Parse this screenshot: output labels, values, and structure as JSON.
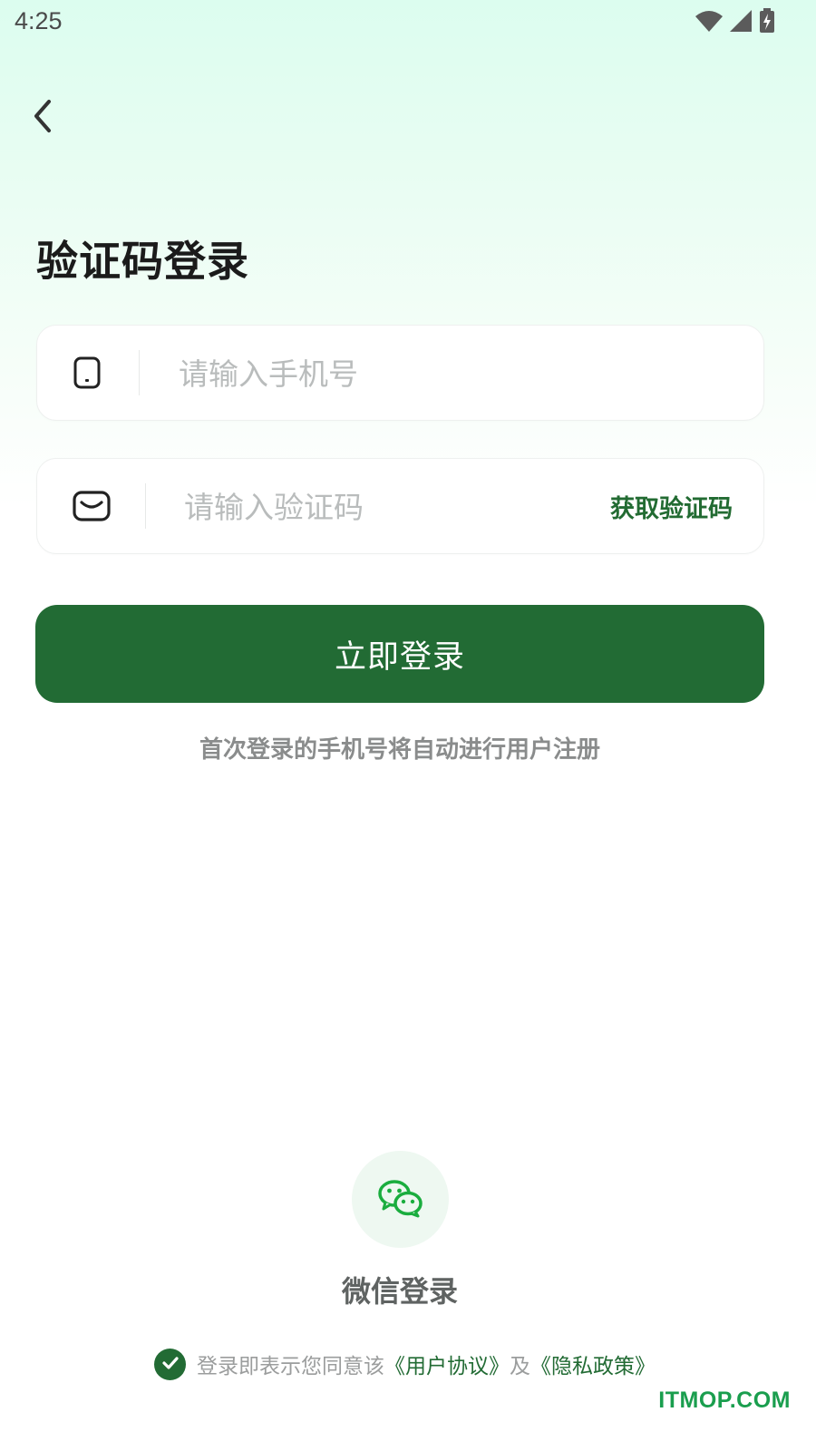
{
  "status_bar": {
    "time": "4:25",
    "icons": [
      "wifi-icon",
      "signal-icon",
      "battery-charging-icon"
    ]
  },
  "nav": {
    "back_icon": "chevron-left-icon"
  },
  "title": "验证码登录",
  "phone_field": {
    "icon": "phone-icon",
    "placeholder": "请输入手机号",
    "value": ""
  },
  "code_field": {
    "icon": "message-icon",
    "placeholder": "请输入验证码",
    "value": "",
    "get_code_label": "获取验证码"
  },
  "login_button": "立即登录",
  "auto_register_note": "首次登录的手机号将自动进行用户注册",
  "wechat": {
    "icon": "wechat-icon",
    "label": "微信登录"
  },
  "agreement": {
    "checked": true,
    "prefix": "登录即表示您同意该",
    "user_agreement": "《用户协议》",
    "conjunction": "及",
    "privacy_policy": "《隐私政策》"
  },
  "watermark": "ITMOP.COM",
  "colors": {
    "primary": "#226b34",
    "wechat_green": "#1aad3e",
    "muted_text": "#8a8c8c"
  }
}
